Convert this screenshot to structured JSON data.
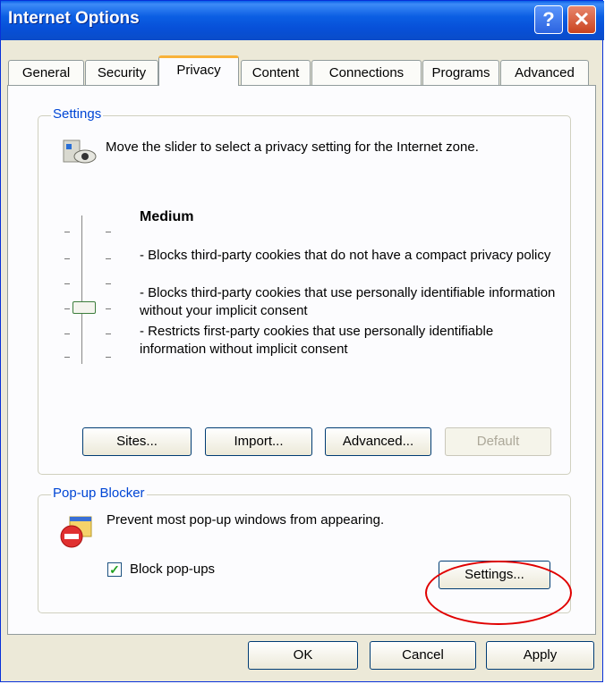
{
  "window": {
    "title": "Internet Options"
  },
  "tabs": [
    "General",
    "Security",
    "Privacy",
    "Content",
    "Connections",
    "Programs",
    "Advanced"
  ],
  "settings": {
    "legend": "Settings",
    "instruction": "Move the slider to select a privacy setting for the Internet zone.",
    "level": "Medium",
    "desc1": "- Blocks third-party cookies that do not have a compact privacy policy",
    "desc2": "- Blocks third-party cookies that use personally identifiable information without your implicit consent",
    "desc3": "- Restricts first-party cookies that use personally identifiable information without implicit consent",
    "buttons": {
      "sites": "Sites...",
      "import": "Import...",
      "advanced": "Advanced...",
      "default": "Default"
    }
  },
  "popup": {
    "legend": "Pop-up Blocker",
    "description": "Prevent most pop-up windows from appearing.",
    "checkbox_label": "Block pop-ups",
    "checked": true,
    "settings_button": "Settings..."
  },
  "footer": {
    "ok": "OK",
    "cancel": "Cancel",
    "apply": "Apply"
  },
  "icons": {
    "privacy": "privacy-eye-icon",
    "popup": "popup-blocked-icon",
    "help": "help-icon",
    "close": "close-icon"
  },
  "colors": {
    "title_bar": "#0a5fe8",
    "legend": "#0046d5",
    "active_tab": "#f8b23a",
    "highlight": "#e00000"
  }
}
